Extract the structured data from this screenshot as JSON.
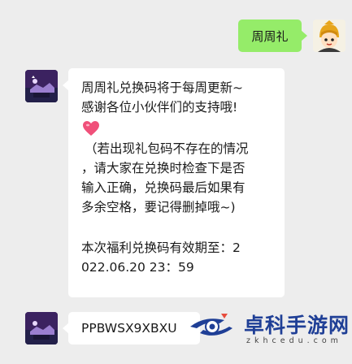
{
  "outgoing": {
    "text": "周周礼"
  },
  "incoming": {
    "lines": [
      "周周礼兑换码将于每周更新~",
      "感谢各位小伙伴们的支持哦!",
      "（若出现礼包码不存在的情况",
      "，请大家在兑换时检查下是否",
      "输入正确，兑换码最后如果有",
      "多余空格，要记得删掉哦~)",
      "本次福利兑换码有效期至：2",
      "022.06.20 23：59"
    ],
    "emoji": "heart"
  },
  "code_message": {
    "text": "PPBWSX9XBXU"
  },
  "watermark": {
    "title": "卓科手游网",
    "domain": "zkhcedu.com"
  },
  "colors": {
    "outgoing_bubble": "#95ec69",
    "incoming_bubble": "#ffffff",
    "background": "#ededed",
    "watermark": "#1f3f96"
  }
}
